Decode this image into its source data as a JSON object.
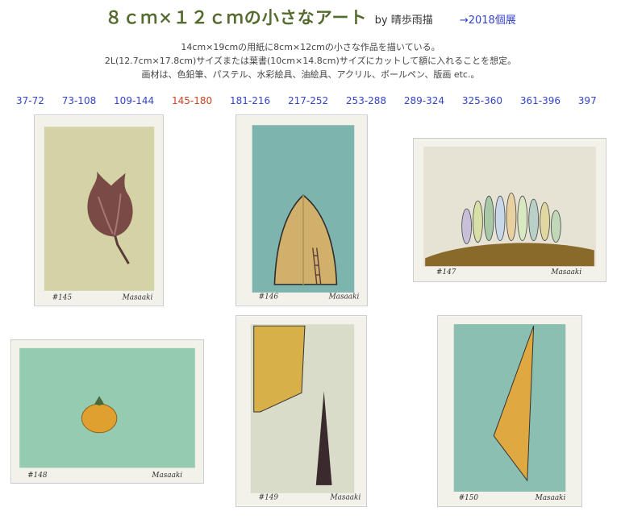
{
  "header": {
    "title": "８ｃｍ×１２ｃｍの小さなアート",
    "byline": "by 晴歩雨描",
    "prev_link": "→2018個展"
  },
  "description": [
    "14cm×19cmの用紙に8cm×12cmの小さな作品を描いている。",
    "2L(12.7cm×17.8cm)サイズまたは葉書(10cm×14.8cm)サイズにカットして額に入れることを想定。",
    "画材は、色鉛筆、パステル、水彩絵具、油絵具、アクリル、ボールペン、版画 etc.。"
  ],
  "nav": {
    "ranges": [
      "37-72",
      "73-108",
      "109-144",
      "145-180",
      "181-216",
      "217-252",
      "253-288",
      "289-324",
      "325-360",
      "361-396",
      "397"
    ],
    "current": "145-180",
    "link_color": "#3344cc",
    "current_color": "#cc4422"
  },
  "artworks": [
    {
      "number": "#145",
      "signature": "Masaaki",
      "subject": "bud"
    },
    {
      "number": "#146",
      "signature": "Masaaki",
      "subject": "leaf"
    },
    {
      "number": "#147",
      "signature": "Masaaki",
      "subject": "hill-with-trees"
    },
    {
      "number": "#148",
      "signature": "Masaaki",
      "subject": "orange"
    },
    {
      "number": "#149",
      "signature": "Masaaki",
      "subject": "shapes"
    },
    {
      "number": "#150",
      "signature": "Masaaki",
      "subject": "triangle"
    }
  ]
}
